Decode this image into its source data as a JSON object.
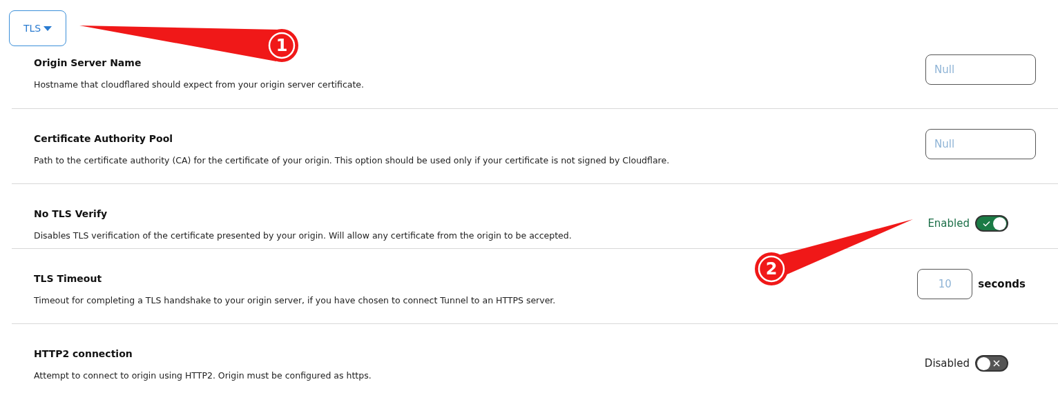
{
  "section_dropdown": {
    "label": "TLS"
  },
  "settings": [
    {
      "title": "Origin Server Name",
      "description": "Hostname that cloudflared should expect from your origin server certificate.",
      "kind": "text",
      "placeholder": "Null"
    },
    {
      "title": "Certificate Authority Pool",
      "description": "Path to the certificate authority (CA) for the certificate of your origin. This option should be used only if your certificate is not signed by Cloudflare.",
      "kind": "text",
      "placeholder": "Null"
    },
    {
      "title": "No TLS Verify",
      "description": "Disables TLS verification of the certificate presented by your origin. Will allow any certificate from the origin to be accepted.",
      "kind": "toggle",
      "on": true,
      "state_label": "Enabled"
    },
    {
      "title": "TLS Timeout",
      "description": "Timeout for completing a TLS handshake to your origin server, if you have chosen to connect Tunnel to an HTTPS server.",
      "kind": "number",
      "placeholder": "10",
      "unit": "seconds"
    },
    {
      "title": "HTTP2 connection",
      "description": "Attempt to connect to origin using HTTP2. Origin must be configured as https.",
      "kind": "toggle",
      "on": false,
      "state_label": "Disabled"
    }
  ],
  "callouts": [
    {
      "number": "1"
    },
    {
      "number": "2"
    }
  ]
}
